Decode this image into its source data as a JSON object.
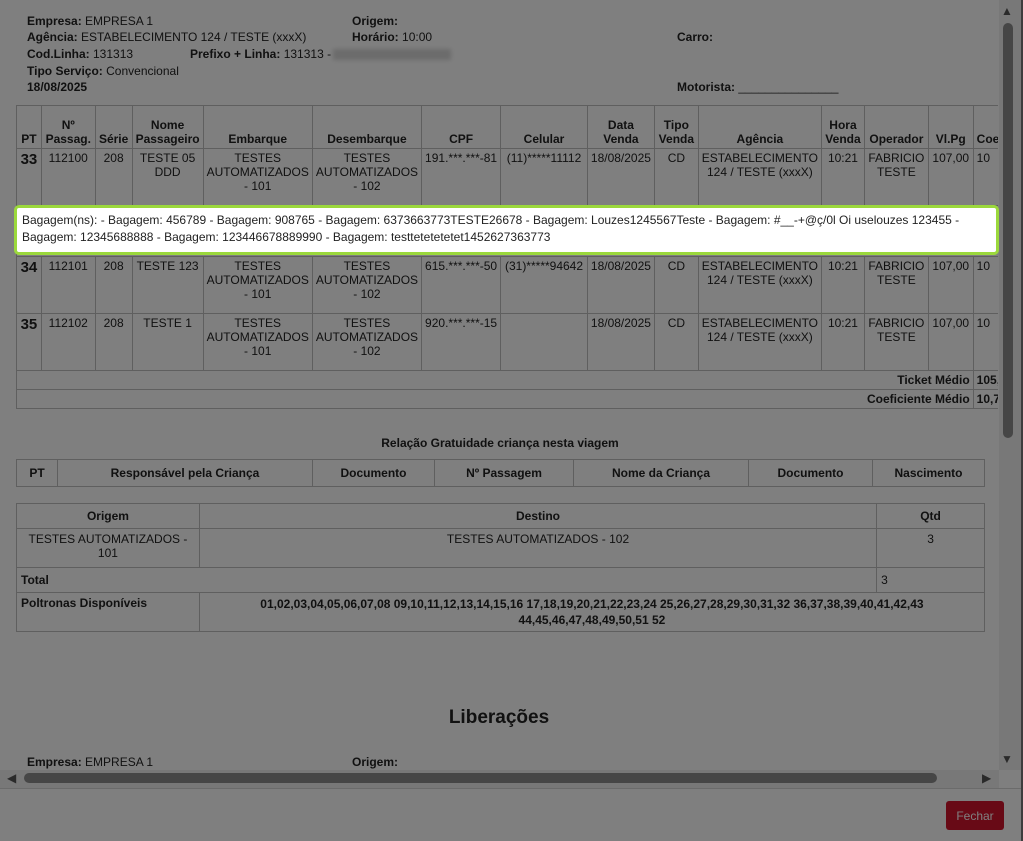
{
  "header": {
    "empresa_label": "Empresa:",
    "empresa_value": "EMPRESA 1",
    "origem_label": "Origem:",
    "agencia_label": "Agência:",
    "agencia_value": "ESTABELECIMENTO 124 / TESTE (xxxX)",
    "horario_label": "Horário:",
    "horario_value": "10:00",
    "carro_label": "Carro:",
    "codlinha_label": "Cod.Linha:",
    "codlinha_value": "131313",
    "prefixo_label": "Prefixo + Linha:",
    "prefixo_value": "131313 -",
    "tiposervico_label": "Tipo Serviço:",
    "tiposervico_value": "Convencional",
    "date": "18/08/2025",
    "motorista_label": "Motorista:",
    "motorista_value": "_______________"
  },
  "table": {
    "headers": [
      "PT",
      "Nº Passag.",
      "Série",
      "Nome Passageiro",
      "Embarque",
      "Desembarque",
      "CPF",
      "Celular",
      "Data Venda",
      "Tipo Venda",
      "Agência",
      "Hora Venda",
      "Operador",
      "Vl.Pg",
      "Coe"
    ],
    "rows": [
      [
        "33",
        "112100",
        "208",
        "TESTE 05 DDD",
        "TESTES AUTOMATIZADOS - 101",
        "TESTES AUTOMATIZADOS - 102",
        "191.***.***-81",
        "(11)*****11112",
        "18/08/2025",
        "CD",
        "ESTABELECIMENTO 124 / TESTE (xxxX)",
        "10:21",
        "FABRICIO TESTE",
        "107,00",
        "10"
      ],
      [
        "34",
        "112101",
        "208",
        "TESTE 123",
        "TESTES AUTOMATIZADOS - 101",
        "TESTES AUTOMATIZADOS - 102",
        "615.***.***-50",
        "(31)*****94642",
        "18/08/2025",
        "CD",
        "ESTABELECIMENTO 124 / TESTE (xxxX)",
        "10:21",
        "FABRICIO TESTE",
        "107,00",
        "10"
      ],
      [
        "35",
        "112102",
        "208",
        "TESTE 1",
        "TESTES AUTOMATIZADOS - 101",
        "TESTES AUTOMATIZADOS - 102",
        "920.***.***-15",
        "",
        "18/08/2025",
        "CD",
        "ESTABELECIMENTO 124 / TESTE (xxxX)",
        "10:21",
        "FABRICIO TESTE",
        "107,00",
        "10"
      ]
    ],
    "ticket_medio_label": "Ticket Médio",
    "ticket_medio_value": "105,",
    "coeficiente_label": "Coeficiente Médio",
    "coeficiente_value": "10,7"
  },
  "bagagem_text": "Bagagem(ns): - Bagagem: 456789 - Bagagem: 908765 - Bagagem: 6373663773TESTE26678 - Bagagem: Louzes1245567Teste - Bagagem: #__-+@ç/0l Oi uselouzes 123455 - Bagagem: 12345688888 - Bagagem: 123446678889990 - Bagagem: testtetetetetet1452627363773",
  "gratuidade": {
    "title": "Relação Gratuidade criança nesta viagem",
    "headers": [
      "PT",
      "Responsável pela Criança",
      "Documento",
      "Nº Passagem",
      "Nome da Criança",
      "Documento",
      "Nascimento"
    ]
  },
  "summary": {
    "headers": [
      "Origem",
      "Destino",
      "Qtd"
    ],
    "origem": "TESTES AUTOMATIZADOS - 101",
    "destino": "TESTES AUTOMATIZADOS - 102",
    "qtd": "3",
    "total_label": "Total",
    "total_value": "3",
    "poltronas_label": "Poltronas Disponíveis",
    "poltronas_value": "01,02,03,04,05,06,07,08 09,10,11,12,13,14,15,16 17,18,19,20,21,22,23,24 25,26,27,28,29,30,31,32 36,37,38,39,40,41,42,43 44,45,46,47,48,49,50,51 52"
  },
  "liberacoes": {
    "title": "Liberações",
    "empresa_label": "Empresa:",
    "empresa_value": "EMPRESA 1",
    "origem_label": "Origem:"
  },
  "footer": {
    "fechar_label": "Fechar"
  },
  "colors": {
    "fechar": "#d0142c",
    "highlight_border": "#9bd83c"
  }
}
